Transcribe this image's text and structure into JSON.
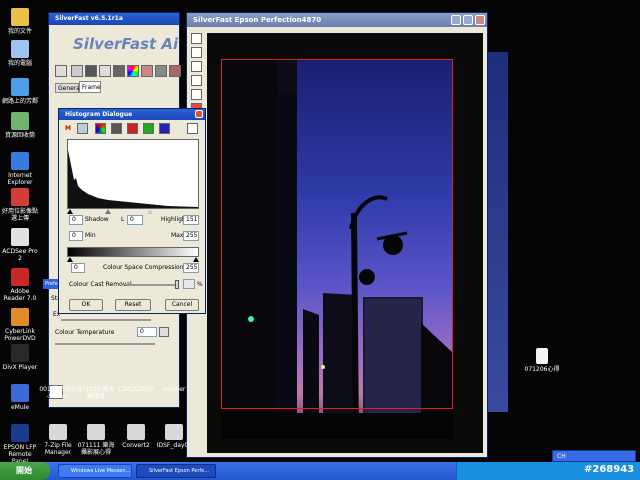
{
  "desktop": {
    "icons_left": [
      {
        "label": "我的文件",
        "color": "#e8c04a"
      },
      {
        "label": "我的電腦",
        "color": "#9cc4ee"
      },
      {
        "label": "網路上的芳鄰",
        "color": "#4d9ee6"
      },
      {
        "label": "資源回收筒",
        "color": "#6fb46f"
      },
      {
        "label": "Internet Explorer",
        "color": "#3a7be0"
      },
      {
        "label": "好用位影像點選上傳",
        "color": "#d43c3c"
      },
      {
        "label": "ACDSee Pro 2",
        "color": "#e0e0e0"
      },
      {
        "label": "Adobe Reader 7.0",
        "color": "#c82828"
      },
      {
        "label": "CyberLink PowerDVD",
        "color": "#e08a2a"
      },
      {
        "label": "DivX Player",
        "color": "#2a2a2a"
      },
      {
        "label": "eMule",
        "color": "#3c6ad8"
      },
      {
        "label": "EPSON LFP Remote Panel",
        "color": "#1a3c8a"
      }
    ],
    "icons_bottom": [
      {
        "label": "001 秘密の力 -Select-"
      },
      {
        "label": "071023 樂大 機隊版"
      },
      {
        "label": "CKACC2007"
      },
      {
        "label": "xoomer"
      },
      {
        "label": "7-Zip File Manager"
      },
      {
        "label": "071111 樂海 攝影展心得"
      },
      {
        "label": "Convert2"
      },
      {
        "label": "IDSF_day0_"
      }
    ],
    "right_icon": {
      "label": "071206心得"
    },
    "watermark": "#268943"
  },
  "silverfast_panel": {
    "title": "SilverFast v6.5.1r1a",
    "logo": "SilverFast Ai",
    "tabs": [
      "General",
      "Frame"
    ],
    "lower_title": "Prefer...",
    "lower_label1": "Sta",
    "lower_label2": "Ex",
    "colour_temperature_label": "Colour Temperature",
    "colour_temperature_value": "0"
  },
  "histogram": {
    "title": "Histogram Dialogue",
    "shadow_value": "0",
    "shadow_label": "Shadow",
    "l_label": "L",
    "l_value": "0",
    "highlight_label": "Highlight",
    "highlight_value": "151",
    "min_value": "0",
    "min_label": "Min",
    "max_label": "Max",
    "max_value": "255",
    "csc_left": "0",
    "csc_label": "Colour Space Compression",
    "csc_right": "255",
    "cast_label": "Colour Cast Removal",
    "cast_unit": "%",
    "ok_label": "OK",
    "reset_label": "Reset",
    "cancel_label": "Cancel"
  },
  "preview_window": {
    "title": "SilverFast Epson Perfection4870"
  },
  "taskbar": {
    "start_label": "開始",
    "tasks": [
      "Windows Live Messen...",
      "SilverFast Epson Perfe..."
    ],
    "lang": "CH",
    "clock": ""
  }
}
